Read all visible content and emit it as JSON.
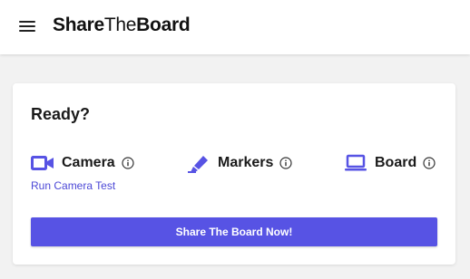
{
  "header": {
    "menu_icon": "hamburger-menu-icon",
    "brand_bold_1": "Share",
    "brand_regular": "The",
    "brand_bold_2": "Board"
  },
  "card": {
    "title": "Ready?",
    "items": [
      {
        "label": "Camera",
        "icon": "video-camera-icon",
        "info_icon": "info-icon"
      },
      {
        "label": "Markers",
        "icon": "marker-pen-icon",
        "info_icon": "info-icon"
      },
      {
        "label": "Board",
        "icon": "laptop-icon",
        "info_icon": "info-icon"
      }
    ],
    "run_test_link": "Run Camera Test",
    "share_button": "Share The Board Now!"
  },
  "colors": {
    "accent": "#5753e4",
    "link": "#4b47d6",
    "background": "#f2f2f2"
  }
}
